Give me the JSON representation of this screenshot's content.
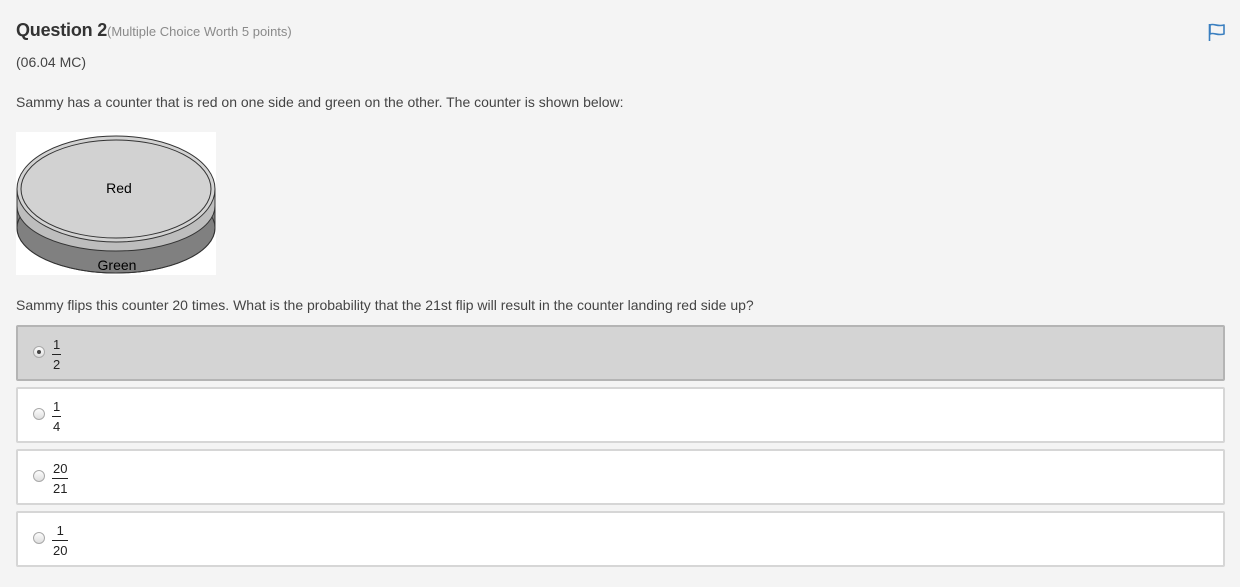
{
  "question": {
    "title": "Question 2",
    "subtitle": "(Multiple Choice Worth 5 points)",
    "code": "(06.04 MC)",
    "prompt": "Sammy has a counter that is red on one side and green on the other. The counter is shown below:",
    "question_text": "Sammy flips this counter 20 times. What is the probability that the 21st flip will result in the counter landing red side up?"
  },
  "flag": {
    "icon": "flag-icon",
    "color": "#3a7fc0"
  },
  "figure": {
    "top_label": "Red",
    "side_label": "Green",
    "top_color": "#d2d2d2",
    "edge_color": "#bdbdbd",
    "bottom_color": "#808080"
  },
  "choices": [
    {
      "numerator": "1",
      "denominator": "2",
      "selected": true
    },
    {
      "numerator": "1",
      "denominator": "4",
      "selected": false
    },
    {
      "numerator": "20",
      "denominator": "21",
      "selected": false
    },
    {
      "numerator": "1",
      "denominator": "20",
      "selected": false
    }
  ]
}
